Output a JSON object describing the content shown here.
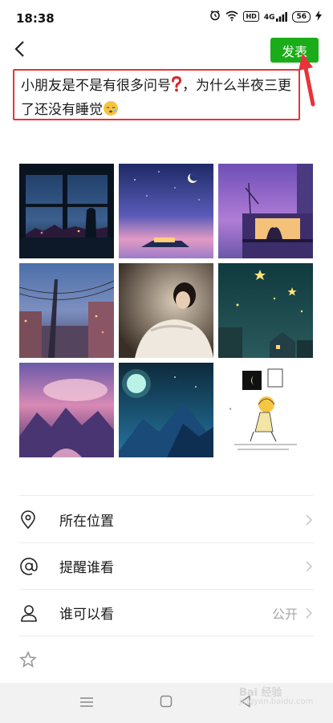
{
  "status_bar": {
    "time": "18:38",
    "icons": [
      "alarm-icon",
      "wifi-icon",
      "hd-icon",
      "signal-4g-icon",
      "battery-icon",
      "charging-icon"
    ],
    "hd": "HD",
    "signal": "4G",
    "battery": "56"
  },
  "header": {
    "back_icon": "chevron-left-icon",
    "publish_label": "发表"
  },
  "post": {
    "text_part1": "小朋友是不是有很多问号",
    "text_part2": "，为什么半夜三更了还没有睡觉",
    "emoji1": "red-question-mark-emoji",
    "emoji2": "sleepy-face-emoji"
  },
  "photos": [
    {
      "name": "photo-window-night-city"
    },
    {
      "name": "photo-moon-purple-sky"
    },
    {
      "name": "photo-couple-balcony"
    },
    {
      "name": "photo-street-power-lines"
    },
    {
      "name": "photo-sleeping-girl"
    },
    {
      "name": "photo-starry-night-town"
    },
    {
      "name": "photo-pink-mountains"
    },
    {
      "name": "photo-blue-moon-mountains"
    },
    {
      "name": "photo-cartoon-sketch"
    }
  ],
  "menu": {
    "location_label": "所在位置",
    "remind_label": "提醒谁看",
    "visibility_label": "谁可以看",
    "visibility_value": "公开"
  },
  "watermark": {
    "text": "Bai 经验",
    "sub": "jingyan.baidu.com"
  },
  "colors": {
    "accent": "#1aad19",
    "highlight": "#e8333a"
  }
}
